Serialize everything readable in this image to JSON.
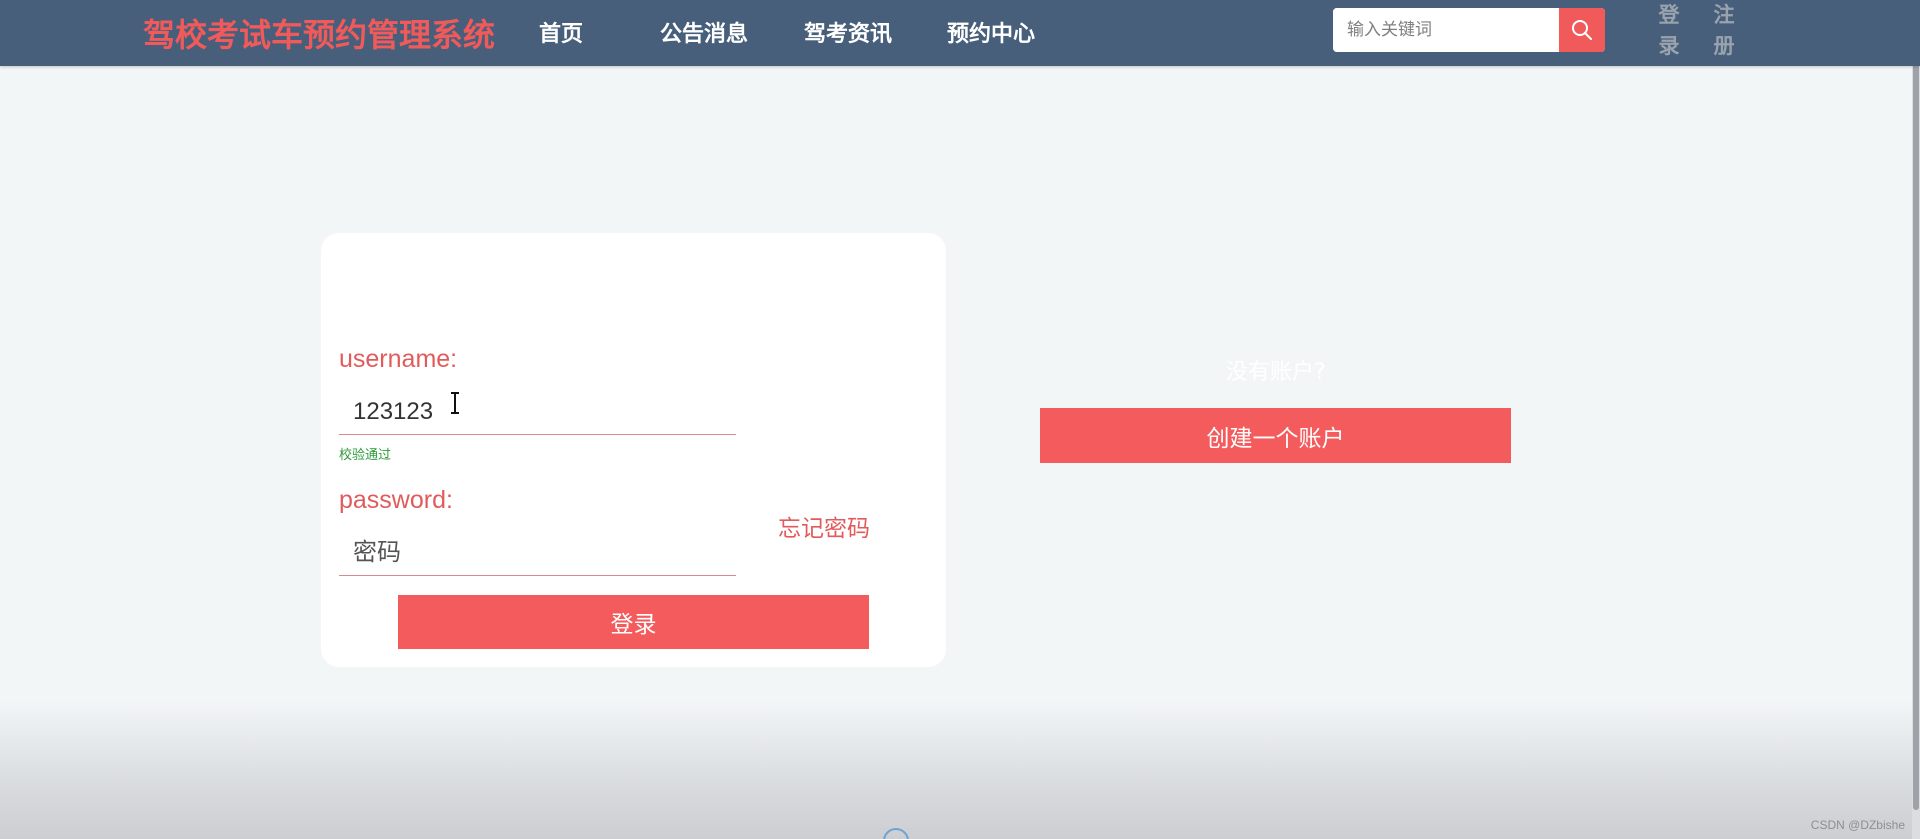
{
  "header": {
    "brand": "驾校考试车预约管理系统",
    "nav": {
      "home": "首页",
      "notice": "公告消息",
      "news": "驾考资讯",
      "booking": "预约中心"
    },
    "search": {
      "placeholder": "输入关键词",
      "icon": "search-icon"
    },
    "auth": {
      "login": "登录",
      "register": "注册"
    }
  },
  "login_form": {
    "username_label": "username:",
    "username_value": "123123",
    "validation_message": "校验通过",
    "password_label": "password:",
    "password_placeholder": "密码",
    "forgot_password": "忘记密码",
    "submit": "登录"
  },
  "register_panel": {
    "prompt": "没有账户?",
    "create_button": "创建一个账户"
  },
  "watermark": "CSDN @DZbishe",
  "colors": {
    "nav_bg": "#475f7b",
    "accent": "#f45b5c",
    "success": "#2e9a3a"
  }
}
